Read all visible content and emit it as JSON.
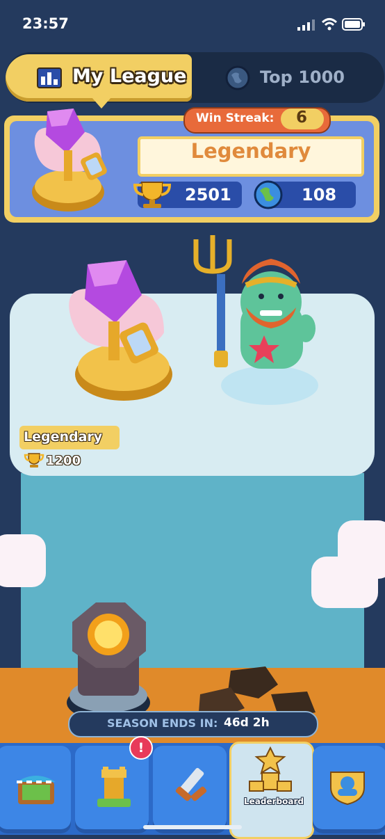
{
  "status_bar": {
    "time": "23:57"
  },
  "tabs": {
    "my_league": "My League",
    "top": "Top 1000"
  },
  "league_card": {
    "win_streak_label": "Win Streak:",
    "win_streak_value": "6",
    "league_name": "Legendary",
    "trophies": "2501",
    "rank": "108"
  },
  "map": {
    "league_tag": "Legendary",
    "league_requirement": "1200"
  },
  "season": {
    "label": "SEASON ENDS IN:",
    "value": "46d 2h"
  },
  "nav": {
    "items": [
      {
        "icon": "shop-icon"
      },
      {
        "icon": "tower-icon",
        "badge": "!"
      },
      {
        "icon": "battle-icon"
      },
      {
        "icon": "leaderboard-icon",
        "label": "Leaderboard",
        "active": true
      },
      {
        "icon": "clan-icon"
      }
    ]
  },
  "colors": {
    "gold": "#f2cf63",
    "card_blue": "#6d8fe0",
    "streak_orange": "#e86a3a",
    "nav_blue": "#3d86e6"
  }
}
